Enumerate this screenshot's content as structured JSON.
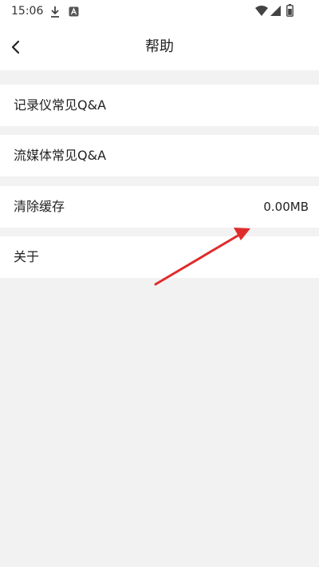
{
  "status_bar": {
    "time": "15:06",
    "icons": [
      "download-icon",
      "app-notification-icon",
      "wifi-icon",
      "signal-icon",
      "battery-icon"
    ]
  },
  "header": {
    "title": "帮助",
    "back_icon": "chevron-left-icon"
  },
  "menu": {
    "items": [
      {
        "label": "记录仪常见Q&A"
      },
      {
        "label": "流媒体常见Q&A"
      },
      {
        "label": "清除缓存",
        "value": "0.00MB"
      },
      {
        "label": "关于"
      }
    ]
  },
  "annotation": {
    "arrow_color": "#e02b2b"
  },
  "colors": {
    "background": "#f2f2f2",
    "surface": "#ffffff",
    "text": "#222222"
  }
}
